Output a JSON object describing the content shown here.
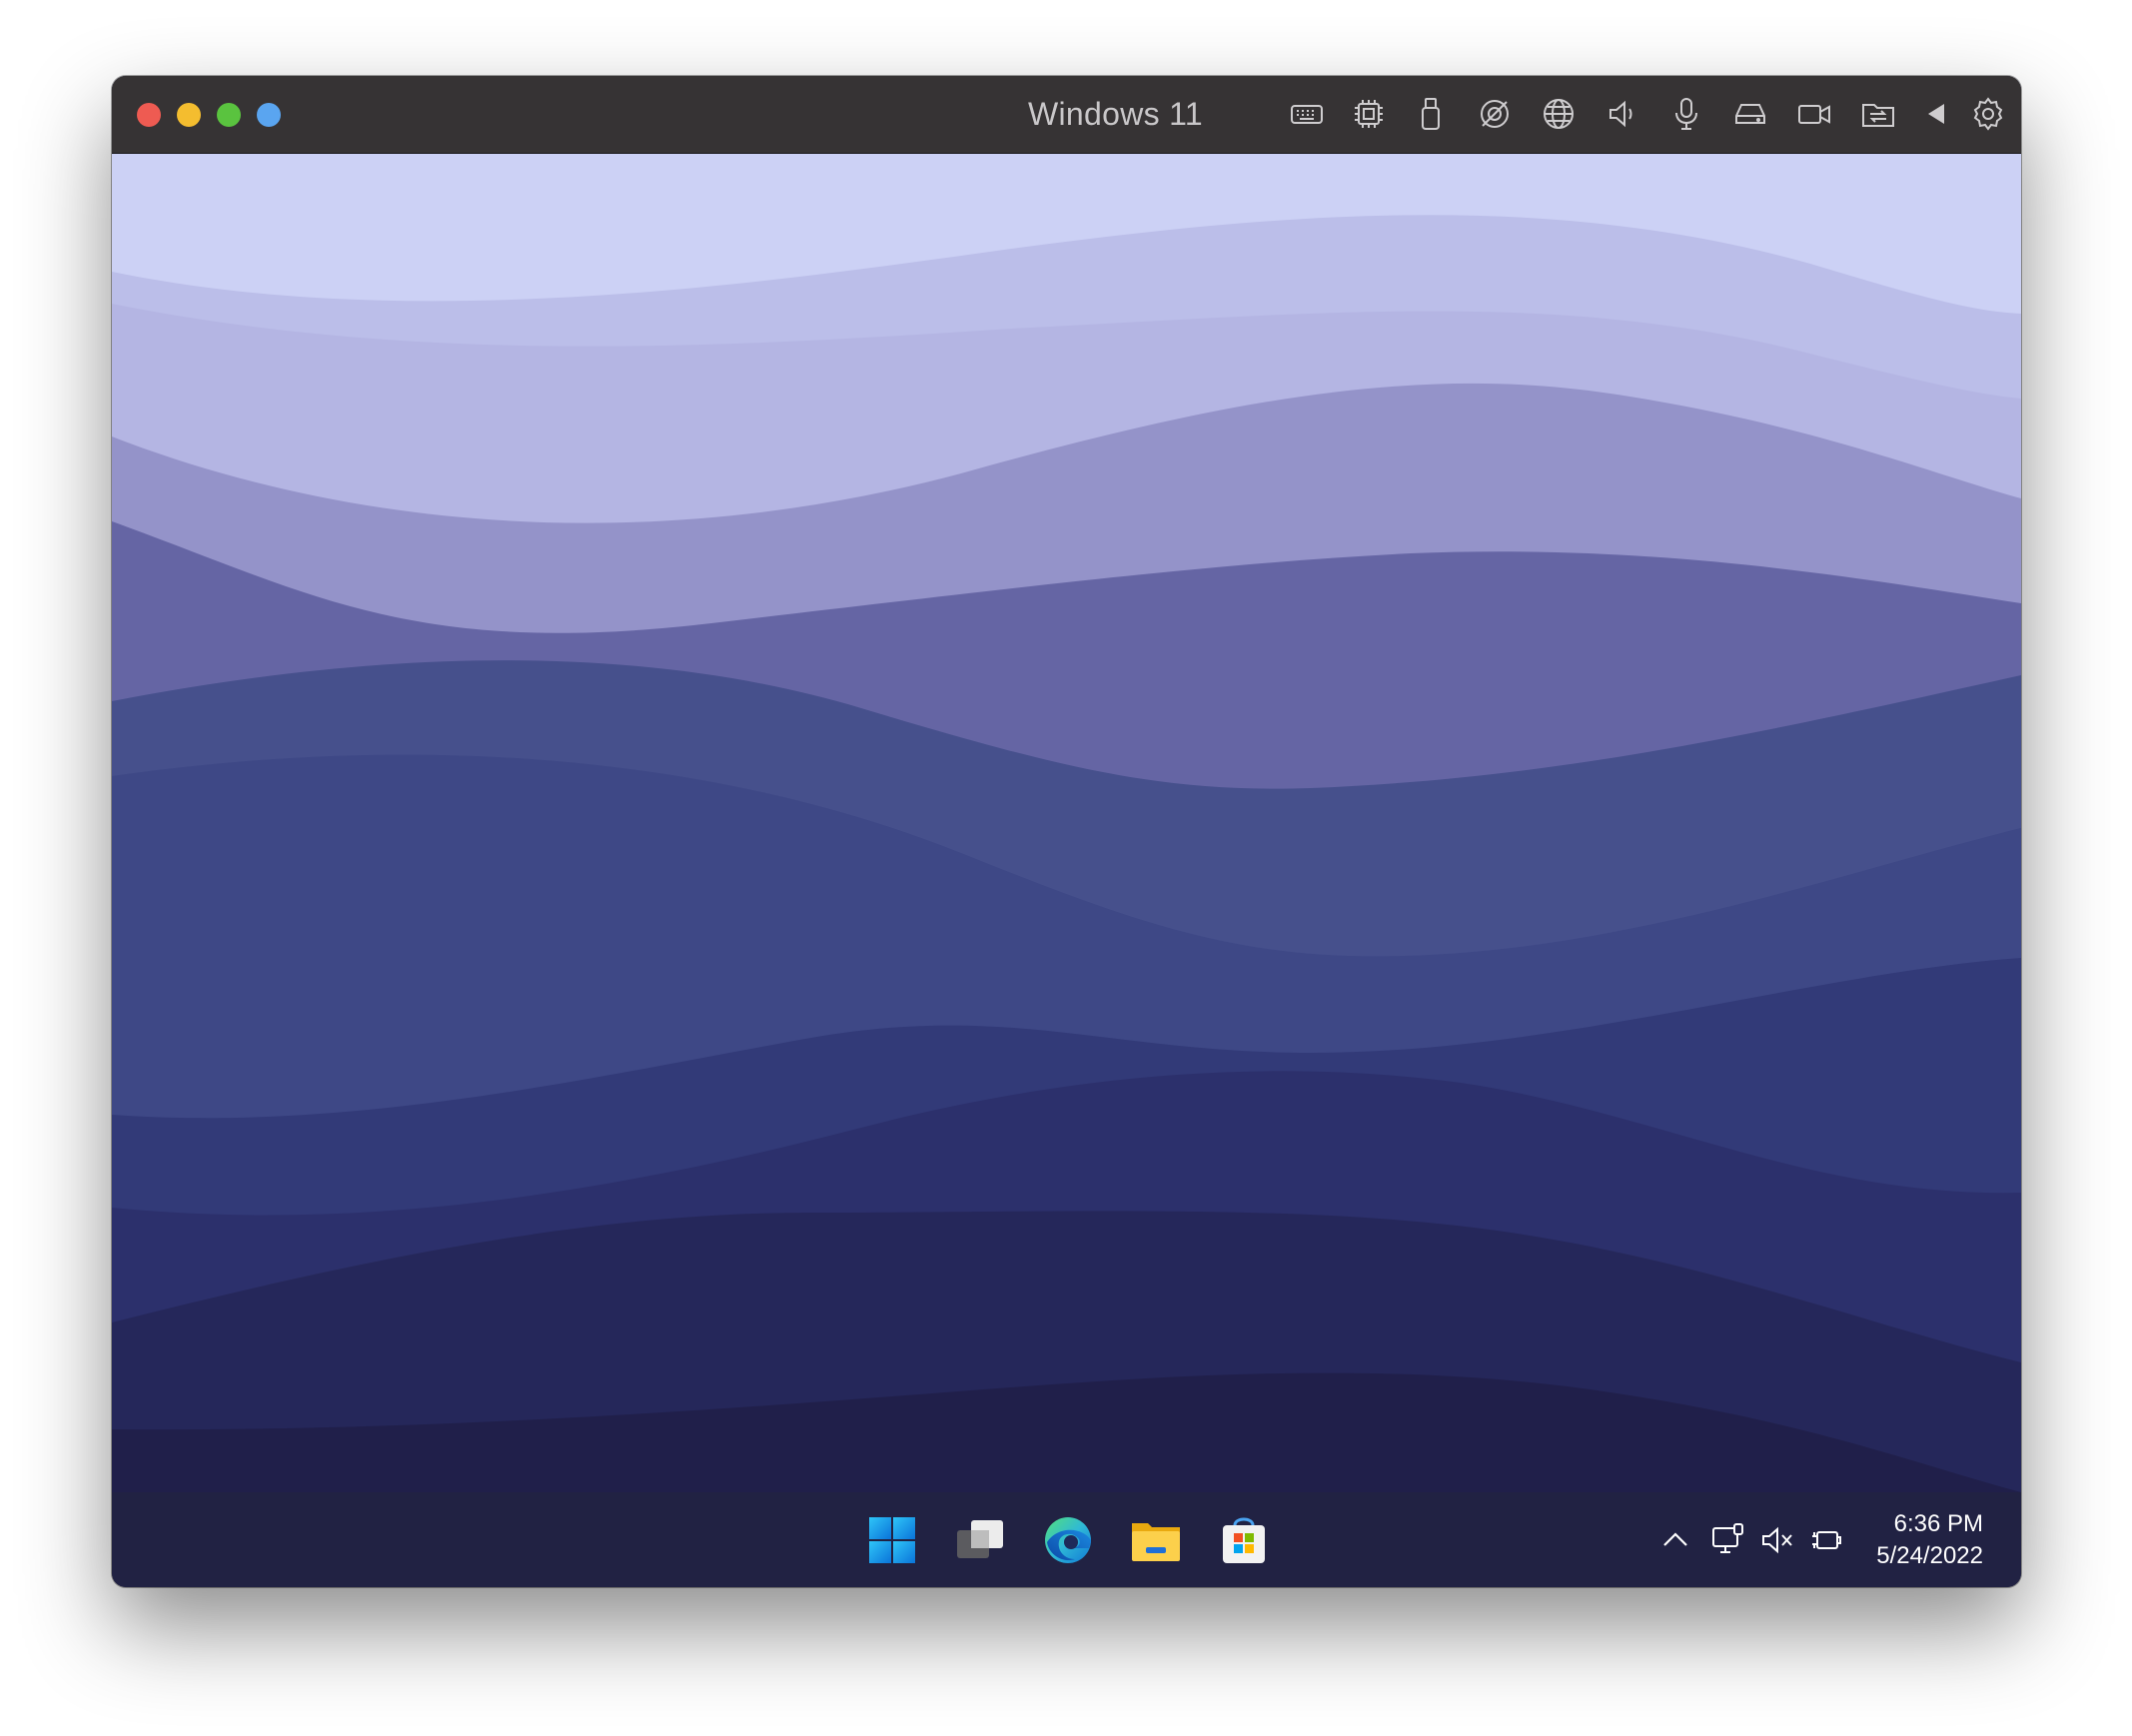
{
  "window": {
    "title": "Windows 11",
    "traffic_lights": [
      "#ee5b52",
      "#f4bd2f",
      "#5ac33f",
      "#5aa5f0"
    ]
  },
  "toolbar": {
    "icons": [
      "keyboard-icon",
      "cpu-icon",
      "usb-icon",
      "camera-off-icon",
      "network-globe-icon",
      "volume-icon",
      "microphone-icon",
      "hard-drive-icon",
      "video-camera-icon",
      "shared-folder-icon",
      "collapse-arrow-icon",
      "settings-gear-icon"
    ]
  },
  "taskbar": {
    "apps": [
      "start-windows-icon",
      "task-view-icon",
      "edge-browser-icon",
      "file-explorer-icon",
      "microsoft-store-icon"
    ],
    "tray_icons": [
      "show-hidden-icons-chevron",
      "network-icon",
      "volume-muted-icon",
      "battery-charging-icon"
    ],
    "time": "6:36 PM",
    "date": "5/24/2022"
  },
  "wallpaper": {
    "colors": [
      "#ccd1f5",
      "#bbbee9",
      "#b4b5e3",
      "#9493c9",
      "#6565a4",
      "#46508c",
      "#3e4886",
      "#323a78",
      "#2c306c",
      "#25275a",
      "#201f4a"
    ]
  }
}
